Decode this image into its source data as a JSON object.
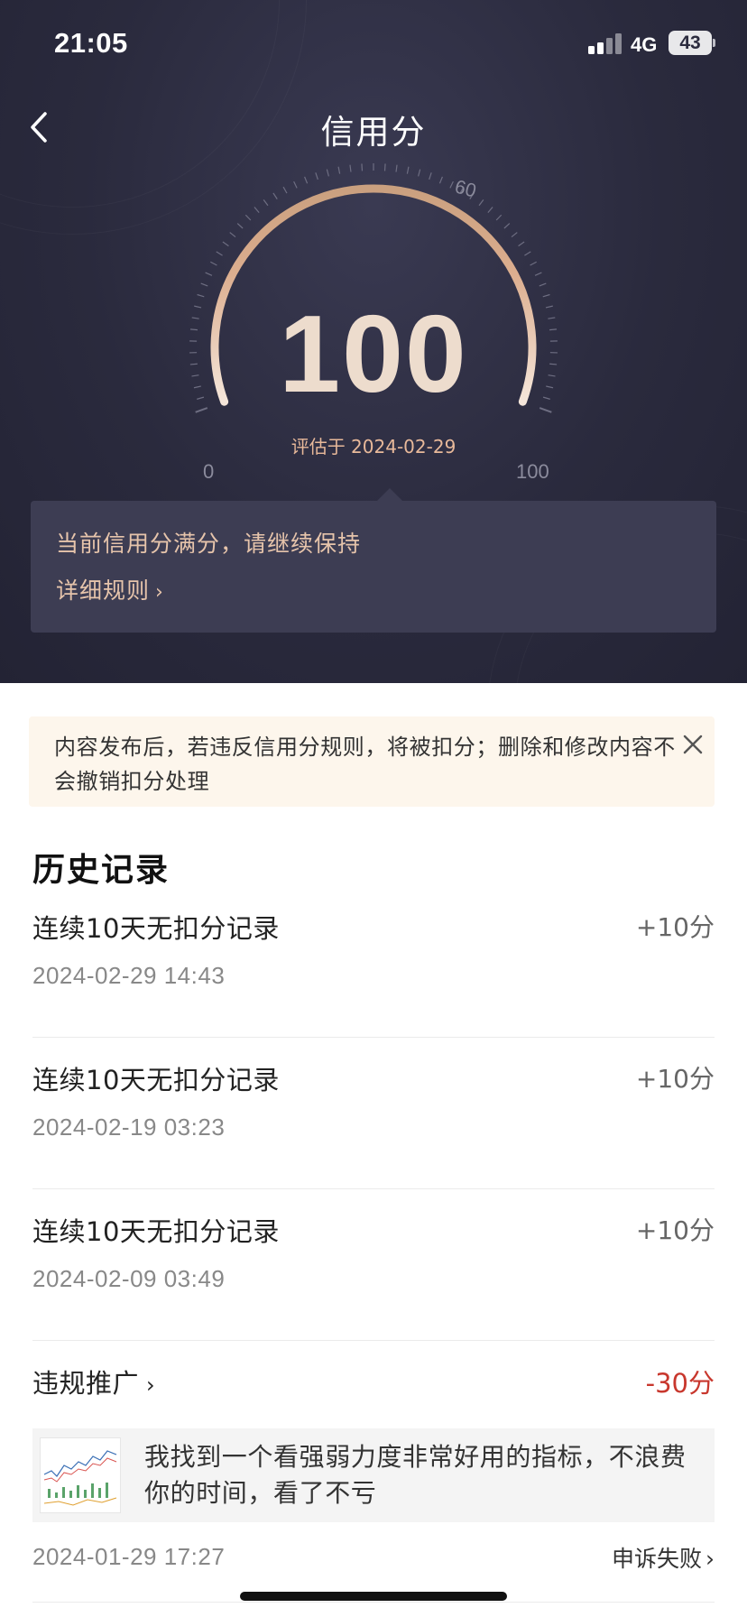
{
  "status_bar": {
    "time": "21:05",
    "network": "4G",
    "battery": "43"
  },
  "header": {
    "title": "信用分"
  },
  "gauge": {
    "score": "100",
    "evaluated_text": "评估于 2024-02-29",
    "min_label": "0",
    "max_label": "100",
    "mid_label": "60",
    "level": 1.0
  },
  "info_card": {
    "message": "当前信用分满分，请继续保持",
    "link_label": "详细规则",
    "link_chevron": "›"
  },
  "notice": {
    "text": "内容发布后，若违反信用分规则，将被扣分；删除和修改内容不会撤销扣分处理"
  },
  "history": {
    "title": "历史记录",
    "records": [
      {
        "title": "连续10天无扣分记录",
        "score": "+10分",
        "date": "2024-02-29 14:43"
      },
      {
        "title": "连续10天无扣分记录",
        "score": "+10分",
        "date": "2024-02-19 03:23"
      },
      {
        "title": "连续10天无扣分记录",
        "score": "+10分",
        "date": "2024-02-09 03:49"
      }
    ],
    "violation": {
      "title": "违规推广",
      "chevron": "›",
      "score": "-30分",
      "post_text": "我找到一个看强弱力度非常好用的指标，不浪费你的时间，看了不亏",
      "date": "2024-01-29 17:27",
      "appeal_label": "申诉失败",
      "appeal_chevron": "›"
    }
  },
  "colors": {
    "header_bg": "#2a2a3d",
    "accent_gold": "#e6c4ab",
    "penalty_red": "#c8372d",
    "notice_bg": "#fdf6ec"
  },
  "icons": {
    "back": "chevron-left-icon",
    "close": "close-icon",
    "signal": "signal-icon",
    "battery": "battery-icon"
  }
}
